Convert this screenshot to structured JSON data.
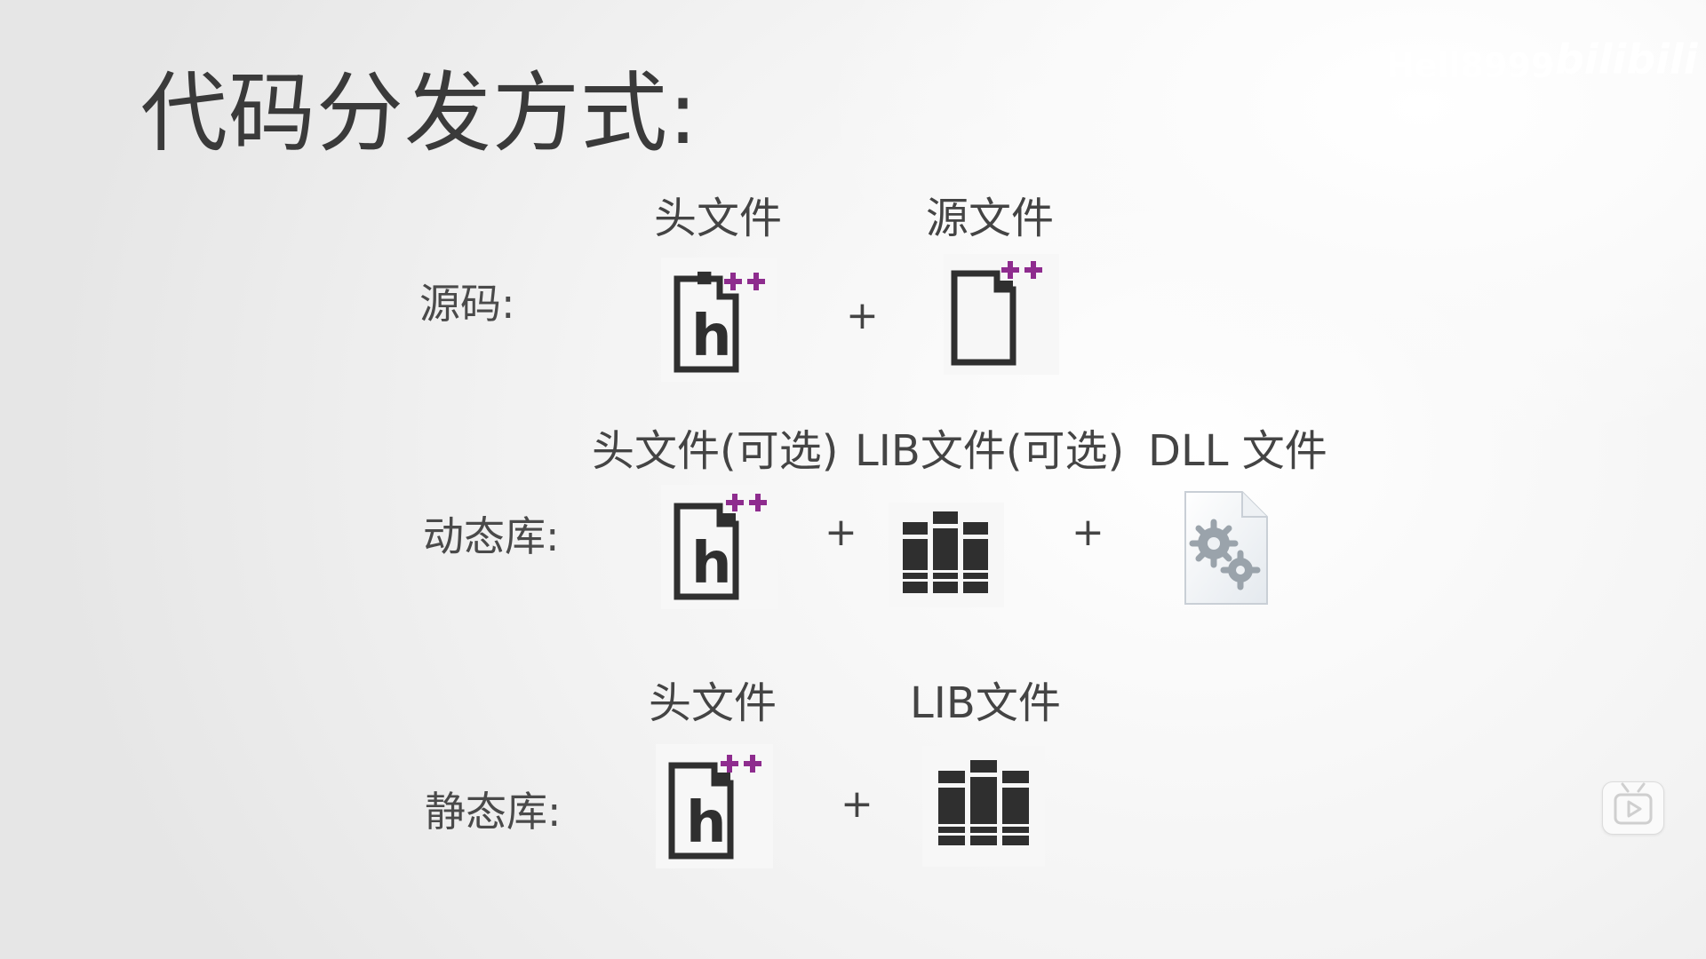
{
  "slide": {
    "title": "代码分发方式:",
    "watermark": "Hell8999",
    "brand_logo": "bilibili",
    "rows": {
      "source": {
        "label": "源码:",
        "captions": [
          "头文件",
          "源文件"
        ],
        "operators": [
          "+"
        ]
      },
      "dynamic": {
        "label": "动态库:",
        "captions": [
          "头文件(可选)",
          "LIB文件(可选)",
          "DLL 文件"
        ],
        "operators": [
          "+",
          "+"
        ]
      },
      "static": {
        "label": "静态库:",
        "captions": [
          "头文件",
          "LIB文件"
        ],
        "operators": [
          "+"
        ]
      }
    }
  },
  "icons": {
    "header": "cpp-header-file-icon",
    "source": "cpp-source-file-icon",
    "lib": "lib-file-icon",
    "dll": "dll-file-icon",
    "player": "bilibili-tv-icon"
  },
  "colors": {
    "accent": "#8e2c8e",
    "icon_dark": "#2f2f2f",
    "text": "#444444"
  }
}
